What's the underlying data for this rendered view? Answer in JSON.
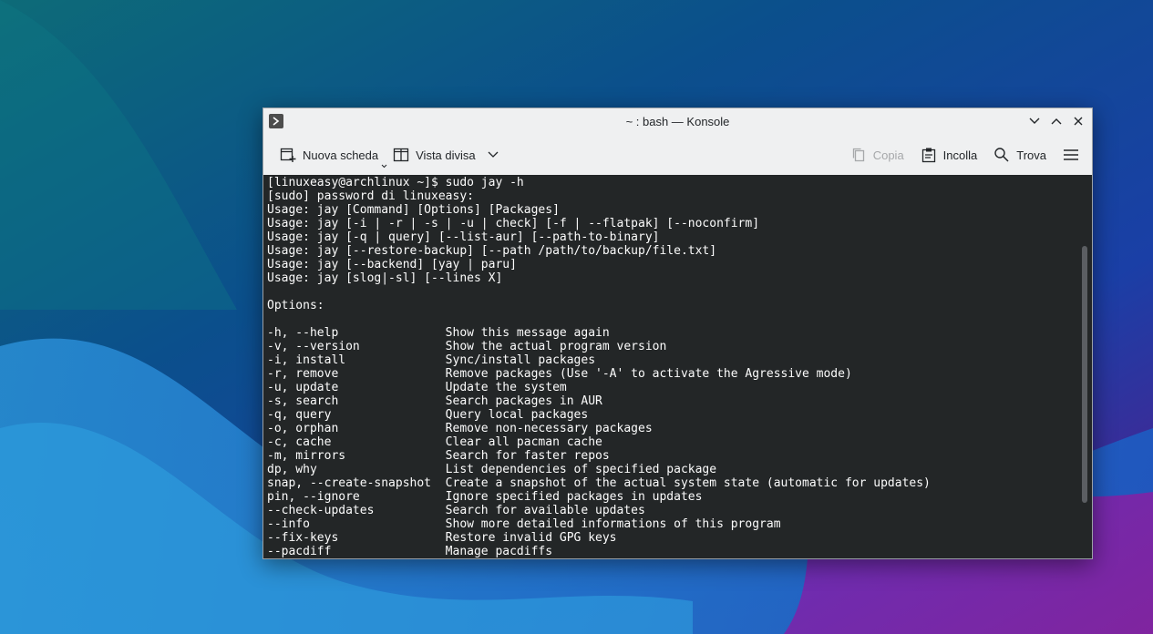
{
  "window": {
    "title": "~ : bash — Konsole"
  },
  "toolbar": {
    "new_tab_label": "Nuova scheda",
    "split_view_label": "Vista divisa",
    "copy_label": "Copia",
    "paste_label": "Incolla",
    "find_label": "Trova"
  },
  "terminal": {
    "lines": [
      "[linuxeasy@archlinux ~]$ sudo jay -h",
      "[sudo] password di linuxeasy:",
      "Usage: jay [Command] [Options] [Packages]",
      "Usage: jay [-i | -r | -s | -u | check] [-f | --flatpak] [--noconfirm]",
      "Usage: jay [-q | query] [--list-aur] [--path-to-binary]",
      "Usage: jay [--restore-backup] [--path /path/to/backup/file.txt]",
      "Usage: jay [--backend] [yay | paru]",
      "Usage: jay [slog|-sl] [--lines X]",
      "",
      "Options:",
      "",
      "-h, --help               Show this message again",
      "-v, --version            Show the actual program version",
      "-i, install              Sync/install packages",
      "-r, remove               Remove packages (Use '-A' to activate the Agressive mode)",
      "-u, update               Update the system",
      "-s, search               Search packages in AUR",
      "-q, query                Query local packages",
      "-o, orphan               Remove non-necessary packages",
      "-c, cache                Clear all pacman cache",
      "-m, mirrors              Search for faster repos",
      "dp, why                  List dependencies of specified package",
      "snap, --create-snapshot  Create a snapshot of the actual system state (automatic for updates)",
      "pin, --ignore            Ignore specified packages in updates",
      "--check-updates          Search for available updates",
      "--info                   Show more detailed informations of this program",
      "--fix-keys               Restore invalid GPG keys",
      "--pacdiff                Manage pacdiffs"
    ]
  },
  "icons": {
    "app": "konsole-icon",
    "minimize": "chevron-down-icon",
    "maximize": "chevron-up-icon",
    "close": "close-icon",
    "new_tab": "new-tab-icon",
    "split_view": "split-view-icon",
    "copy": "copy-icon",
    "paste": "paste-icon",
    "find": "search-icon",
    "menu": "hamburger-menu-icon"
  },
  "colors": {
    "terminal_background": "#232627",
    "terminal_foreground": "#fcfcfc",
    "window_chrome": "#eff0f1"
  }
}
